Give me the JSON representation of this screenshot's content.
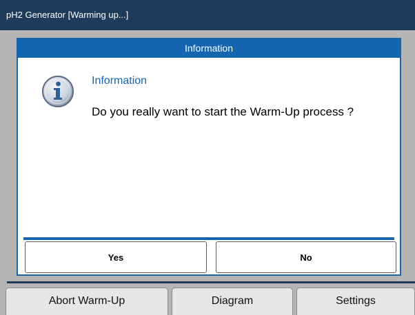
{
  "window": {
    "title": "pH2 Generator  [Warming up...]"
  },
  "dialog": {
    "header": "Information",
    "heading": "Information",
    "message": "Do you really want to start the Warm-Up process ?",
    "icon": "info-icon",
    "buttons": {
      "yes": "Yes",
      "no": "No"
    }
  },
  "tabs": [
    {
      "label": "Abort Warm-Up"
    },
    {
      "label": "Diagram"
    },
    {
      "label": "Settings"
    }
  ],
  "colors": {
    "titlebar": "#1c3c5a",
    "accent": "#1565b0",
    "background": "#b5b5b5"
  }
}
